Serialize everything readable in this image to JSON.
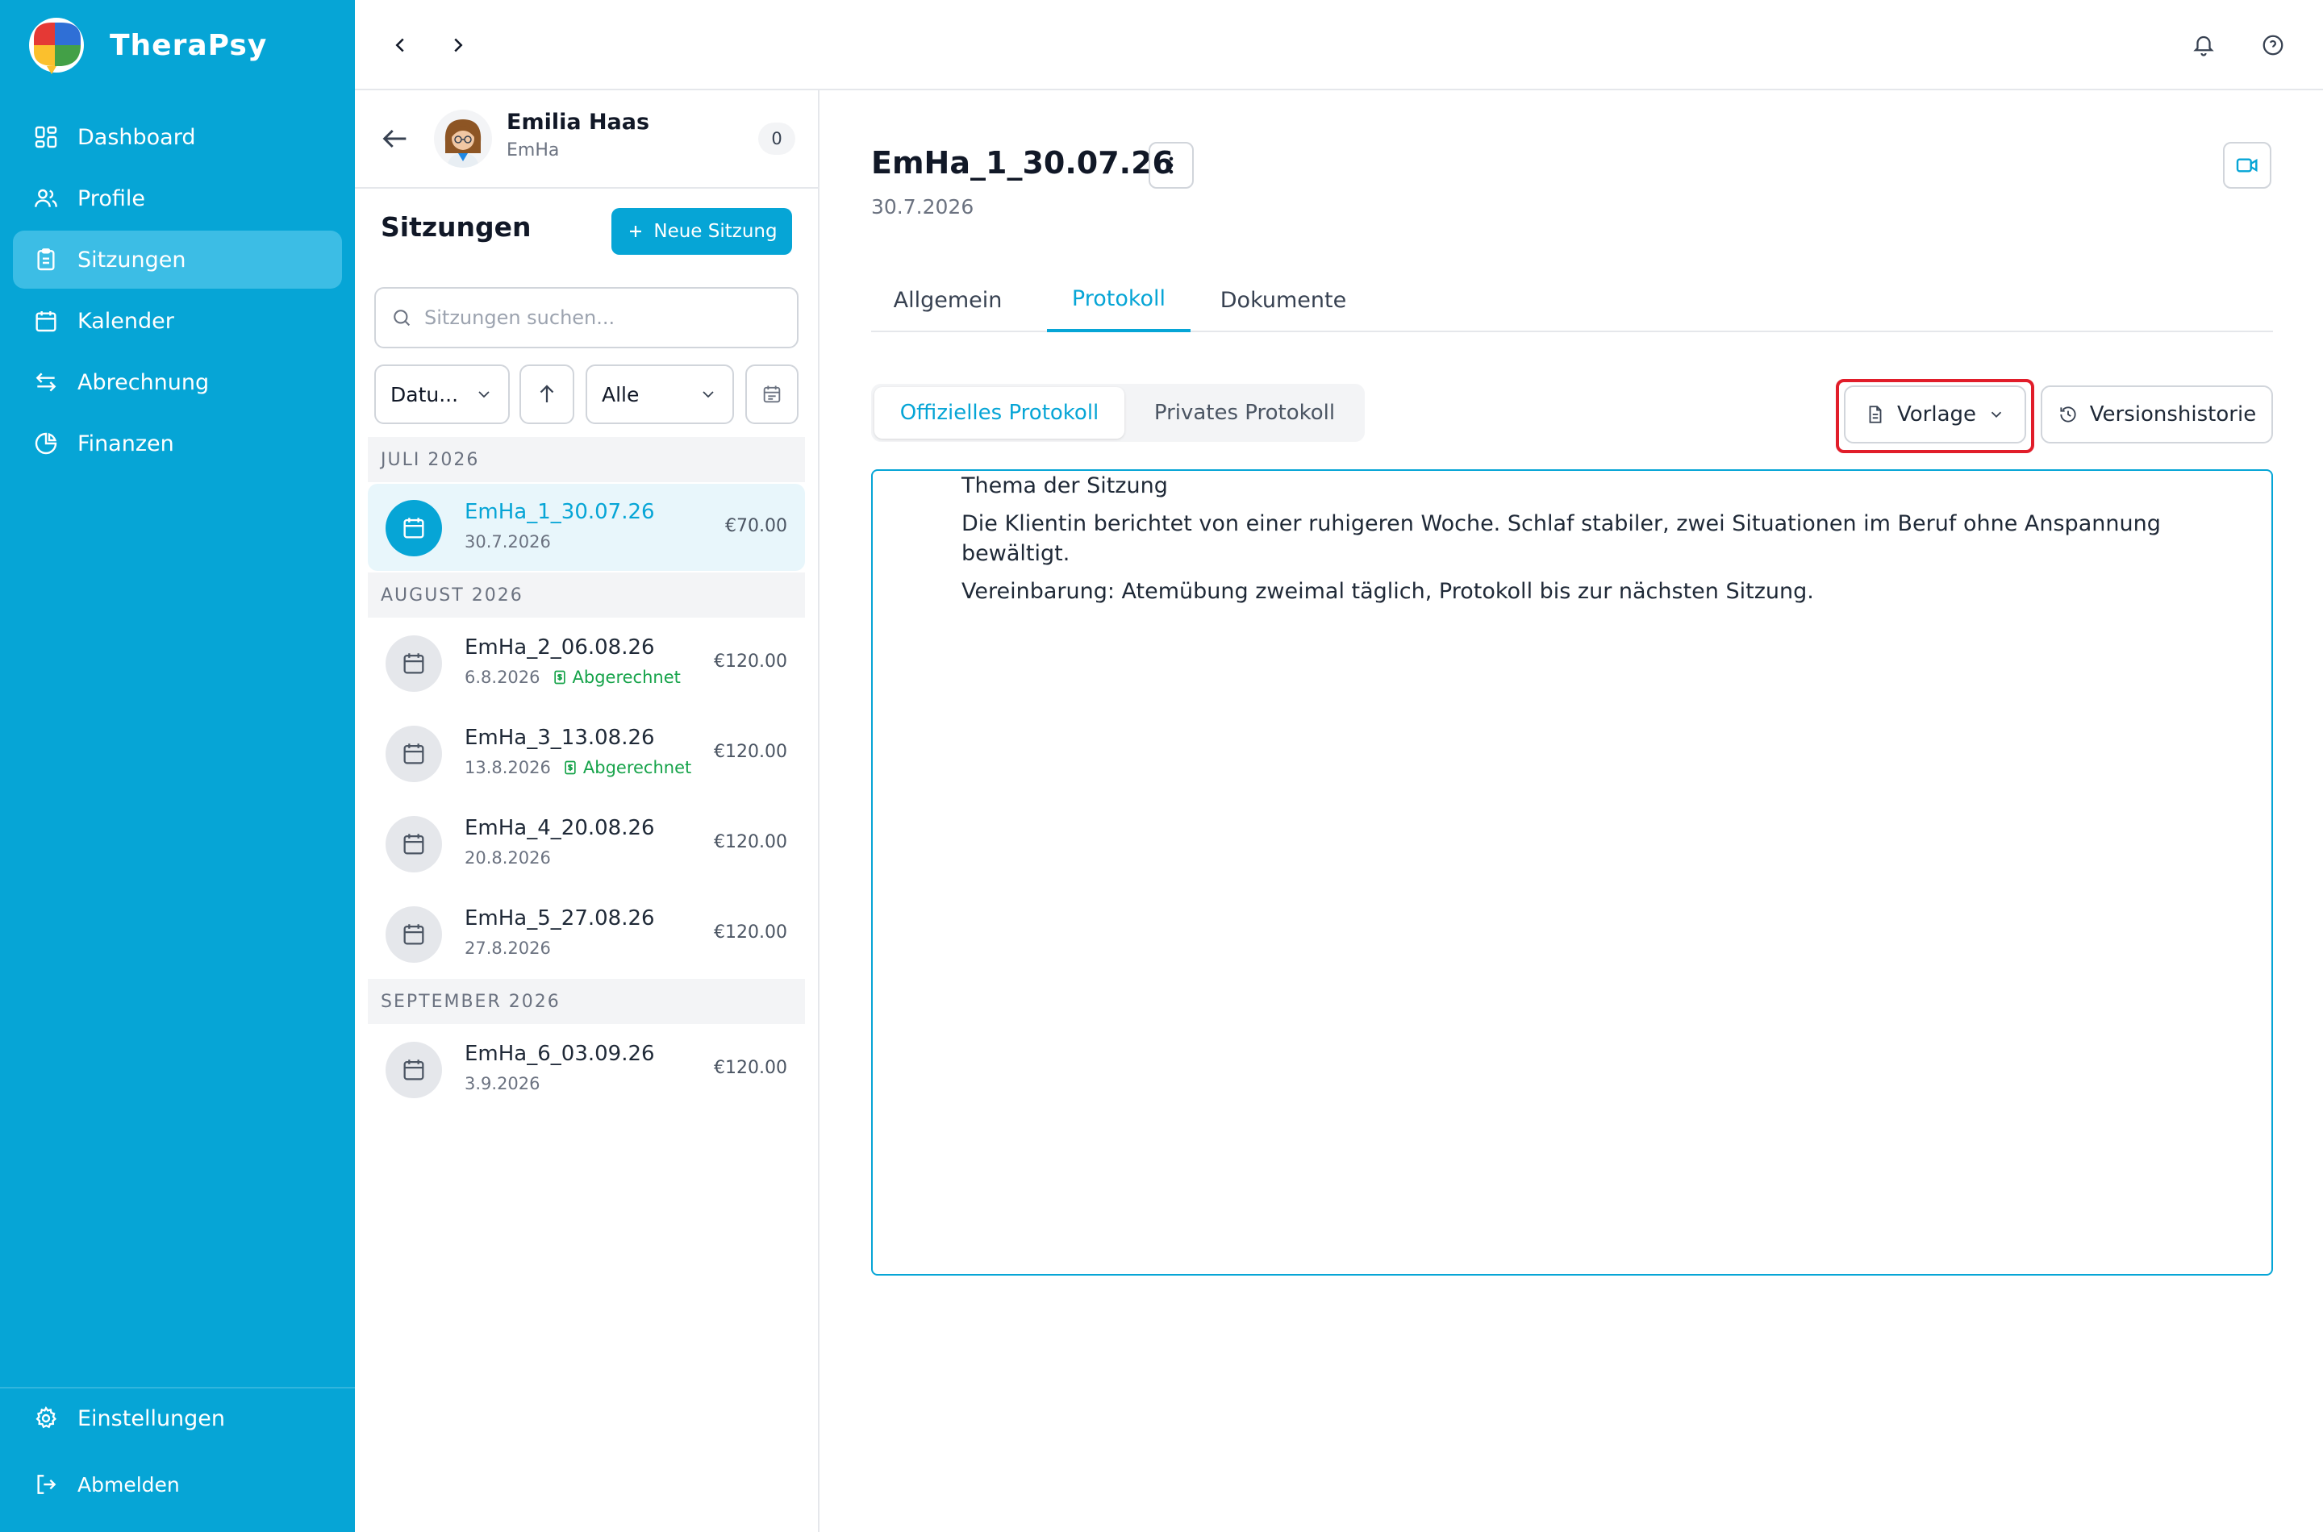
{
  "app": {
    "brand_name": "TheraPsy"
  },
  "sidebar": {
    "nav": [
      {
        "label": "Dashboard",
        "icon": "dashboard-icon"
      },
      {
        "label": "Profile",
        "icon": "users-icon"
      },
      {
        "label": "Sitzungen",
        "icon": "clipboard-icon",
        "active": true
      },
      {
        "label": "Kalender",
        "icon": "calendar-icon"
      },
      {
        "label": "Abrechnung",
        "icon": "arrows-exchange-icon"
      },
      {
        "label": "Finanzen",
        "icon": "pie-chart-icon"
      }
    ],
    "settings_label": "Einstellungen",
    "logout_label": "Abmelden"
  },
  "client": {
    "name": "Emilia Haas",
    "code": "EmHa",
    "count": "0"
  },
  "sessions_panel": {
    "title": "Sitzungen",
    "new_button": "Neue Sitzung",
    "search_placeholder": "Sitzungen suchen...",
    "sort_field": "Datu...",
    "filter_value": "Alle",
    "months": [
      {
        "label": "JULI 2026",
        "sessions": [
          {
            "name": "EmHa_1_30.07.26",
            "date": "30.7.2026",
            "price": "€70.00",
            "active": true,
            "status": ""
          }
        ]
      },
      {
        "label": "AUGUST 2026",
        "sessions": [
          {
            "name": "EmHa_2_06.08.26",
            "date": "6.8.2026",
            "price": "€120.00",
            "status": "Abgerechnet"
          },
          {
            "name": "EmHa_3_13.08.26",
            "date": "13.8.2026",
            "price": "€120.00",
            "status": "Abgerechnet"
          },
          {
            "name": "EmHa_4_20.08.26",
            "date": "20.8.2026",
            "price": "€120.00",
            "status": ""
          },
          {
            "name": "EmHa_5_27.08.26",
            "date": "27.8.2026",
            "price": "€120.00",
            "status": ""
          }
        ]
      },
      {
        "label": "SEPTEMBER 2026",
        "sessions": [
          {
            "name": "EmHa_6_03.09.26",
            "date": "3.9.2026",
            "price": "€120.00",
            "status": ""
          }
        ]
      }
    ]
  },
  "detail": {
    "title": "EmHa_1_30.07.26",
    "date": "30.7.2026",
    "tabs": [
      {
        "label": "Allgemein"
      },
      {
        "label": "Protokoll",
        "active": true
      },
      {
        "label": "Dokumente"
      }
    ],
    "protocol_tabs": [
      {
        "label": "Offizielles Protokoll",
        "active": true
      },
      {
        "label": "Privates Protokoll"
      }
    ],
    "template_button": "Vorlage",
    "history_button": "Versionshistorie",
    "editor_paragraphs": [
      "Thema der Sitzung",
      "Die Klientin berichtet von einer ruhigeren Woche. Schlaf stabiler, zwei Situationen im Beruf ohne Anspannung bewältigt.",
      "Vereinbarung: Atemübung zweimal täglich, Protokoll bis zur nächsten Sitzung."
    ]
  },
  "colors": {
    "brand": "#06a5d6",
    "highlight": "#e11d2a",
    "success": "#16a34a"
  }
}
